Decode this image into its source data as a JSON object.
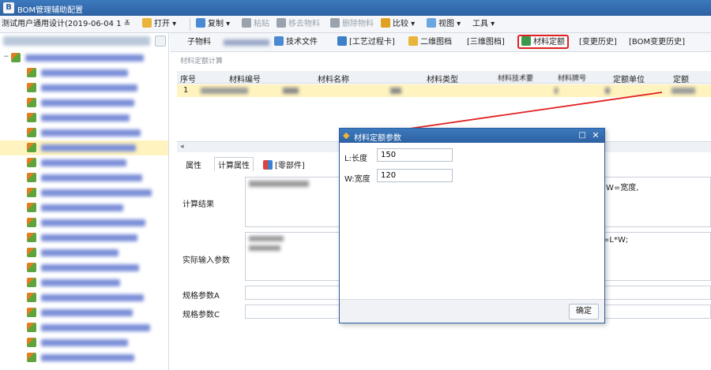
{
  "window": {
    "title": "BOM管理辅助配置"
  },
  "toolbar": {
    "scheme_value": "测试用户通用设计(2019-06-04 1",
    "open": "打开",
    "copy": "复制",
    "paste": "粘贴",
    "move_material": "移去物料",
    "delete_material": "删除物料",
    "compare": "比较",
    "view": "视图",
    "tools": "工具"
  },
  "tabs": {
    "child_material": "子物料",
    "tech_doc": "技术文件",
    "process_card": "[工艺过程卡]",
    "drawing_2d": "二维图档",
    "drawing_3d": "[三维图档]",
    "material_quota": "材料定额",
    "change_history": "[变更历史]",
    "bom_change_history": "[BOM变更历史]"
  },
  "section": {
    "calc_label": "材料定额计算"
  },
  "grid": {
    "headers": [
      "序号",
      "材料编号",
      "材料名称",
      "材料类型",
      "材料技术要",
      "材料牌号",
      "定额单位",
      "定额"
    ],
    "row": {
      "index": "1"
    }
  },
  "props": {
    "tab_attr": "属性",
    "tab_calc": "计算属性",
    "tab_parts": "[零部件]",
    "calc_result_label": "计算结果",
    "actual_input_label": "实际输入参数",
    "spec_a_label": "规格参数A",
    "spec_c_label": "规格参数C",
    "formula_hint": "W=宽度,",
    "input_hint": "=L*W;"
  },
  "dialog": {
    "title": "材料定额参数",
    "length_label": "L:长度",
    "length_value": "150",
    "width_label": "W:宽度",
    "width_value": "120",
    "ok": "确定"
  },
  "colors": {
    "accent": "#2d62a3",
    "selection": "#fff3bf",
    "highlight": "#e02020"
  },
  "icons": {
    "open": "folder-icon",
    "copy": "copy-icon",
    "paste": "paste-icon",
    "compare": "compare-icon",
    "view": "view-icon",
    "tech_doc": "document-icon",
    "process_card": "process-icon",
    "quota": "quota-icon",
    "dialog": "pin-icon"
  }
}
